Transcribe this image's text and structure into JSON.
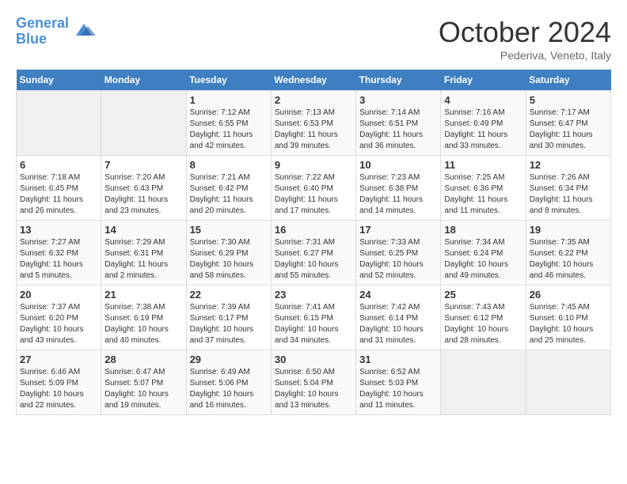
{
  "header": {
    "logo_line1": "General",
    "logo_line2": "Blue",
    "month_title": "October 2024",
    "subtitle": "Pederiva, Veneto, Italy"
  },
  "days_of_week": [
    "Sunday",
    "Monday",
    "Tuesday",
    "Wednesday",
    "Thursday",
    "Friday",
    "Saturday"
  ],
  "weeks": [
    [
      {
        "day": "",
        "info": ""
      },
      {
        "day": "",
        "info": ""
      },
      {
        "day": "1",
        "info": "Sunrise: 7:12 AM\nSunset: 6:55 PM\nDaylight: 11 hours and 42 minutes."
      },
      {
        "day": "2",
        "info": "Sunrise: 7:13 AM\nSunset: 6:53 PM\nDaylight: 11 hours and 39 minutes."
      },
      {
        "day": "3",
        "info": "Sunrise: 7:14 AM\nSunset: 6:51 PM\nDaylight: 11 hours and 36 minutes."
      },
      {
        "day": "4",
        "info": "Sunrise: 7:16 AM\nSunset: 6:49 PM\nDaylight: 11 hours and 33 minutes."
      },
      {
        "day": "5",
        "info": "Sunrise: 7:17 AM\nSunset: 6:47 PM\nDaylight: 11 hours and 30 minutes."
      }
    ],
    [
      {
        "day": "6",
        "info": "Sunrise: 7:18 AM\nSunset: 6:45 PM\nDaylight: 11 hours and 26 minutes."
      },
      {
        "day": "7",
        "info": "Sunrise: 7:20 AM\nSunset: 6:43 PM\nDaylight: 11 hours and 23 minutes."
      },
      {
        "day": "8",
        "info": "Sunrise: 7:21 AM\nSunset: 6:42 PM\nDaylight: 11 hours and 20 minutes."
      },
      {
        "day": "9",
        "info": "Sunrise: 7:22 AM\nSunset: 6:40 PM\nDaylight: 11 hours and 17 minutes."
      },
      {
        "day": "10",
        "info": "Sunrise: 7:23 AM\nSunset: 6:38 PM\nDaylight: 11 hours and 14 minutes."
      },
      {
        "day": "11",
        "info": "Sunrise: 7:25 AM\nSunset: 6:36 PM\nDaylight: 11 hours and 11 minutes."
      },
      {
        "day": "12",
        "info": "Sunrise: 7:26 AM\nSunset: 6:34 PM\nDaylight: 11 hours and 8 minutes."
      }
    ],
    [
      {
        "day": "13",
        "info": "Sunrise: 7:27 AM\nSunset: 6:32 PM\nDaylight: 11 hours and 5 minutes."
      },
      {
        "day": "14",
        "info": "Sunrise: 7:29 AM\nSunset: 6:31 PM\nDaylight: 11 hours and 2 minutes."
      },
      {
        "day": "15",
        "info": "Sunrise: 7:30 AM\nSunset: 6:29 PM\nDaylight: 10 hours and 58 minutes."
      },
      {
        "day": "16",
        "info": "Sunrise: 7:31 AM\nSunset: 6:27 PM\nDaylight: 10 hours and 55 minutes."
      },
      {
        "day": "17",
        "info": "Sunrise: 7:33 AM\nSunset: 6:25 PM\nDaylight: 10 hours and 52 minutes."
      },
      {
        "day": "18",
        "info": "Sunrise: 7:34 AM\nSunset: 6:24 PM\nDaylight: 10 hours and 49 minutes."
      },
      {
        "day": "19",
        "info": "Sunrise: 7:35 AM\nSunset: 6:22 PM\nDaylight: 10 hours and 46 minutes."
      }
    ],
    [
      {
        "day": "20",
        "info": "Sunrise: 7:37 AM\nSunset: 6:20 PM\nDaylight: 10 hours and 43 minutes."
      },
      {
        "day": "21",
        "info": "Sunrise: 7:38 AM\nSunset: 6:19 PM\nDaylight: 10 hours and 40 minutes."
      },
      {
        "day": "22",
        "info": "Sunrise: 7:39 AM\nSunset: 6:17 PM\nDaylight: 10 hours and 37 minutes."
      },
      {
        "day": "23",
        "info": "Sunrise: 7:41 AM\nSunset: 6:15 PM\nDaylight: 10 hours and 34 minutes."
      },
      {
        "day": "24",
        "info": "Sunrise: 7:42 AM\nSunset: 6:14 PM\nDaylight: 10 hours and 31 minutes."
      },
      {
        "day": "25",
        "info": "Sunrise: 7:43 AM\nSunset: 6:12 PM\nDaylight: 10 hours and 28 minutes."
      },
      {
        "day": "26",
        "info": "Sunrise: 7:45 AM\nSunset: 6:10 PM\nDaylight: 10 hours and 25 minutes."
      }
    ],
    [
      {
        "day": "27",
        "info": "Sunrise: 6:46 AM\nSunset: 5:09 PM\nDaylight: 10 hours and 22 minutes."
      },
      {
        "day": "28",
        "info": "Sunrise: 6:47 AM\nSunset: 5:07 PM\nDaylight: 10 hours and 19 minutes."
      },
      {
        "day": "29",
        "info": "Sunrise: 6:49 AM\nSunset: 5:06 PM\nDaylight: 10 hours and 16 minutes."
      },
      {
        "day": "30",
        "info": "Sunrise: 6:50 AM\nSunset: 5:04 PM\nDaylight: 10 hours and 13 minutes."
      },
      {
        "day": "31",
        "info": "Sunrise: 6:52 AM\nSunset: 5:03 PM\nDaylight: 10 hours and 11 minutes."
      },
      {
        "day": "",
        "info": ""
      },
      {
        "day": "",
        "info": ""
      }
    ]
  ]
}
